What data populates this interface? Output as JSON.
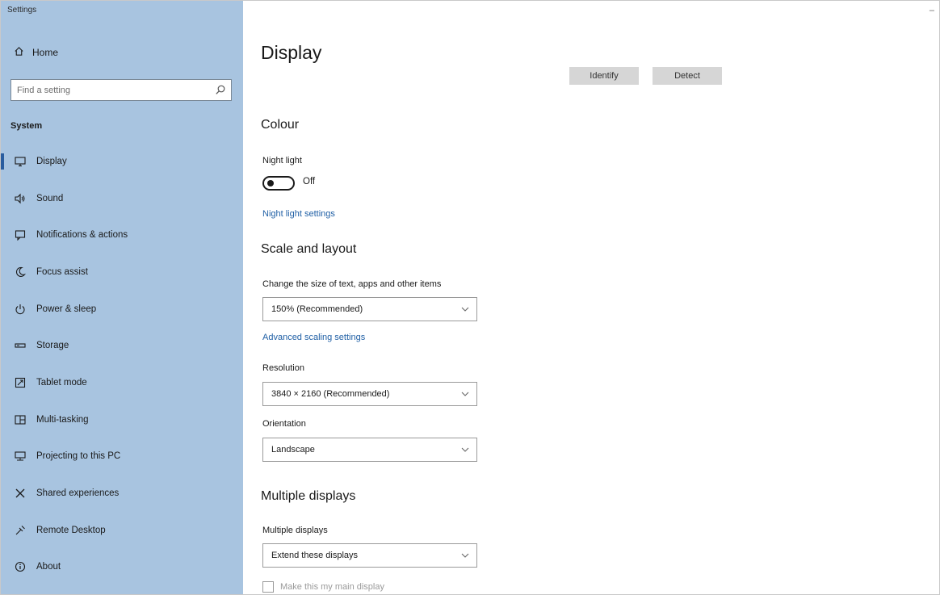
{
  "window": {
    "app_title": "Settings",
    "minimize_glyph": "–"
  },
  "sidebar": {
    "home_label": "Home",
    "search": {
      "placeholder": "Find a setting",
      "value": ""
    },
    "section_label": "System",
    "items": [
      {
        "label": "Display",
        "icon": "monitor-icon",
        "active": true
      },
      {
        "label": "Sound",
        "icon": "speaker-icon",
        "active": false
      },
      {
        "label": "Notifications & actions",
        "icon": "notification-icon",
        "active": false
      },
      {
        "label": "Focus assist",
        "icon": "moon-icon",
        "active": false
      },
      {
        "label": "Power & sleep",
        "icon": "power-icon",
        "active": false
      },
      {
        "label": "Storage",
        "icon": "storage-icon",
        "active": false
      },
      {
        "label": "Tablet mode",
        "icon": "tablet-icon",
        "active": false
      },
      {
        "label": "Multi-tasking",
        "icon": "multitasking-icon",
        "active": false
      },
      {
        "label": "Projecting to this PC",
        "icon": "projecting-icon",
        "active": false
      },
      {
        "label": "Shared experiences",
        "icon": "shared-icon",
        "active": false
      },
      {
        "label": "Remote Desktop",
        "icon": "remote-icon",
        "active": false
      },
      {
        "label": "About",
        "icon": "info-icon",
        "active": false
      }
    ]
  },
  "main": {
    "page_title": "Display",
    "identify_label": "Identify",
    "detect_label": "Detect",
    "colour": {
      "heading": "Colour",
      "night_light_label": "Night light",
      "night_light_state": "Off",
      "night_light_on": false,
      "night_light_settings_link": "Night light settings"
    },
    "scale": {
      "heading": "Scale and layout",
      "size_label": "Change the size of text, apps and other items",
      "size_value": "150% (Recommended)",
      "advanced_link": "Advanced scaling settings",
      "resolution_label": "Resolution",
      "resolution_value": "3840 × 2160 (Recommended)",
      "orientation_label": "Orientation",
      "orientation_value": "Landscape"
    },
    "multiple": {
      "heading": "Multiple displays",
      "label": "Multiple displays",
      "value": "Extend these displays",
      "checkbox_label": "Make this my main display",
      "checkbox_checked": false
    }
  },
  "colors": {
    "sidebar_bg": "#a8c4e0",
    "link": "#1f5fa5",
    "button_bg": "#d6d6d6"
  }
}
